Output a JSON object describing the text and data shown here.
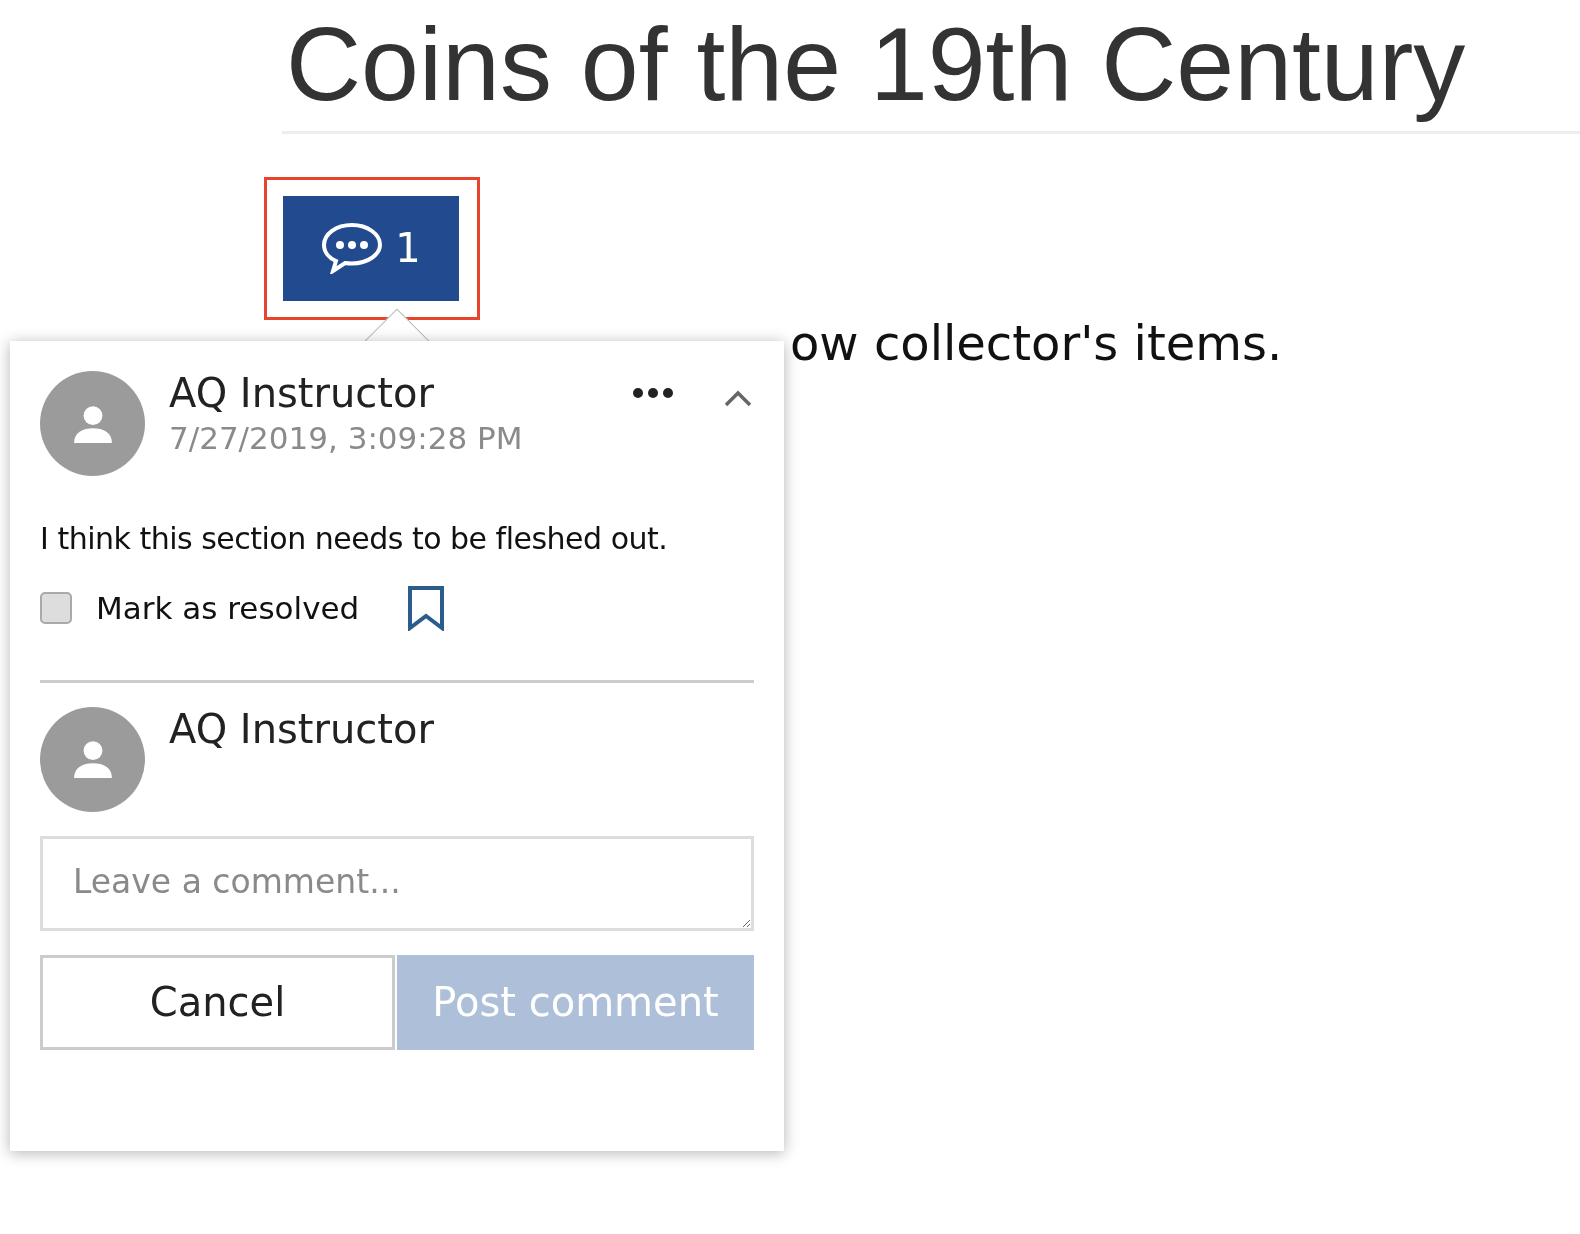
{
  "page": {
    "title": "Coins of the 19th Century",
    "body_text": "ow collector's items."
  },
  "comment_button": {
    "count": "1",
    "highlighted": true
  },
  "popover": {
    "comments": [
      {
        "author": "AQ Instructor",
        "timestamp": "7/27/2019, 3:09:28 PM",
        "text": "I think this section needs to be fleshed out.",
        "resolve_label": "Mark as resolved",
        "resolved": false,
        "expanded": true
      }
    ],
    "reply": {
      "author": "AQ Instructor",
      "placeholder": "Leave a comment...",
      "cancel": "Cancel",
      "post": "Post comment",
      "post_disabled": true
    }
  }
}
